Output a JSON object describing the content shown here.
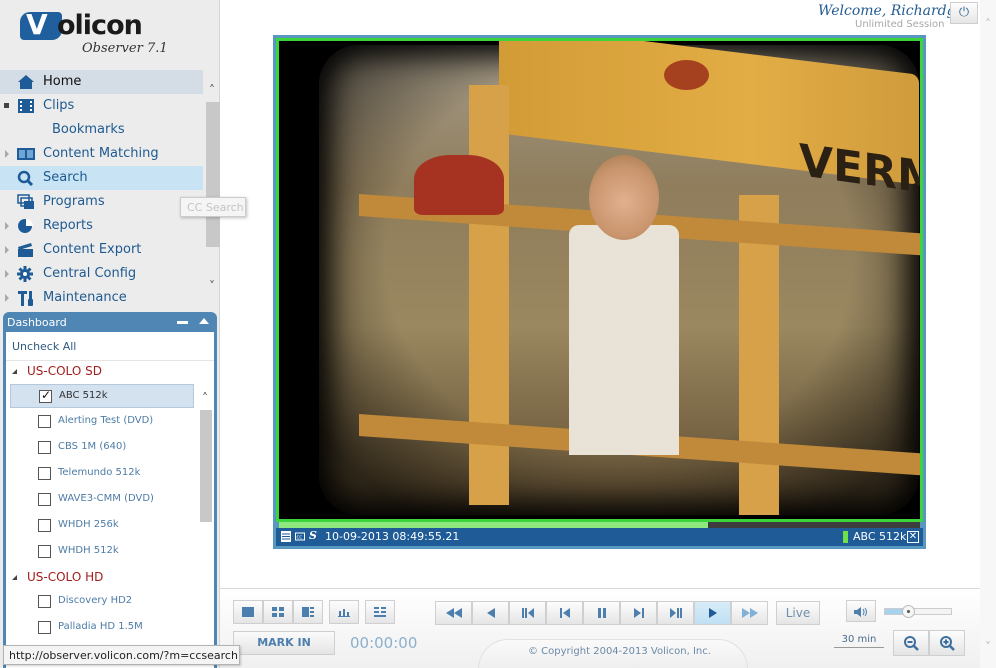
{
  "app": {
    "logo_text": "olicon",
    "logo_letter": "V",
    "product": "Observer 7.1"
  },
  "header": {
    "welcome": "Welcome, Richardg",
    "session": "Unlimited Session",
    "power_icon": "power-icon"
  },
  "nav": {
    "items": [
      {
        "label": "Home",
        "icon": "home-icon",
        "state": "active"
      },
      {
        "label": "Clips",
        "icon": "film-icon",
        "expanded": true
      },
      {
        "label": "Bookmarks",
        "sub": true
      },
      {
        "label": "Content Matching",
        "icon": "content-matching-icon"
      },
      {
        "label": "Search",
        "icon": "search-icon",
        "state": "hover"
      },
      {
        "label": "Programs",
        "icon": "programs-icon"
      },
      {
        "label": "Reports",
        "icon": "pie-chart-icon"
      },
      {
        "label": "Content Export",
        "icon": "clapperboard-icon"
      },
      {
        "label": "Central Config",
        "icon": "gear-icon"
      },
      {
        "label": "Maintenance",
        "icon": "tools-icon"
      }
    ],
    "tooltip": "CC Search"
  },
  "dashboard": {
    "title": "Dashboard",
    "uncheck_all": "Uncheck All",
    "groups": [
      {
        "name": "US-COLO SD",
        "channels": [
          {
            "label": "ABC 512k",
            "checked": true
          },
          {
            "label": "Alerting Test (DVD)",
            "checked": false
          },
          {
            "label": "CBS 1M (640)",
            "checked": false
          },
          {
            "label": "Telemundo 512k",
            "checked": false
          },
          {
            "label": "WAVE3-CMM (DVD)",
            "checked": false
          },
          {
            "label": "WHDH 256k",
            "checked": false
          },
          {
            "label": "WHDH 512k",
            "checked": false
          }
        ]
      },
      {
        "name": "US-COLO HD",
        "channels": [
          {
            "label": "Discovery HD2",
            "checked": false
          },
          {
            "label": "Palladia HD 1.5M",
            "checked": false
          }
        ]
      }
    ]
  },
  "status_url": "http://observer.volicon.com/?m=ccsearch",
  "player": {
    "video_text": "VERM",
    "progress_percent": 67,
    "timestamp": "10-09-2013 08:49:55.21",
    "channel": "ABC 512k",
    "accent_green": "#3bd53b",
    "info_bar_color": "#1e5b97"
  },
  "controls": {
    "layout_buttons": [
      "single-view-icon",
      "quad-view-icon",
      "split-view-icon",
      "bar-chart-icon",
      "list-view-icon"
    ],
    "mark_in": "MARK IN",
    "timecode": "00:00:00",
    "transport": [
      "fast-rewind-icon",
      "rewind-icon",
      "step-back-frame-icon",
      "skip-back-icon",
      "pause-icon",
      "skip-forward-icon",
      "step-forward-frame-icon",
      "play-icon",
      "fast-forward-icon"
    ],
    "live": "Live",
    "volume_percent": 35,
    "zoom_range": "30 min",
    "copyright": "© Copyright 2004-2013 Volicon, Inc."
  }
}
